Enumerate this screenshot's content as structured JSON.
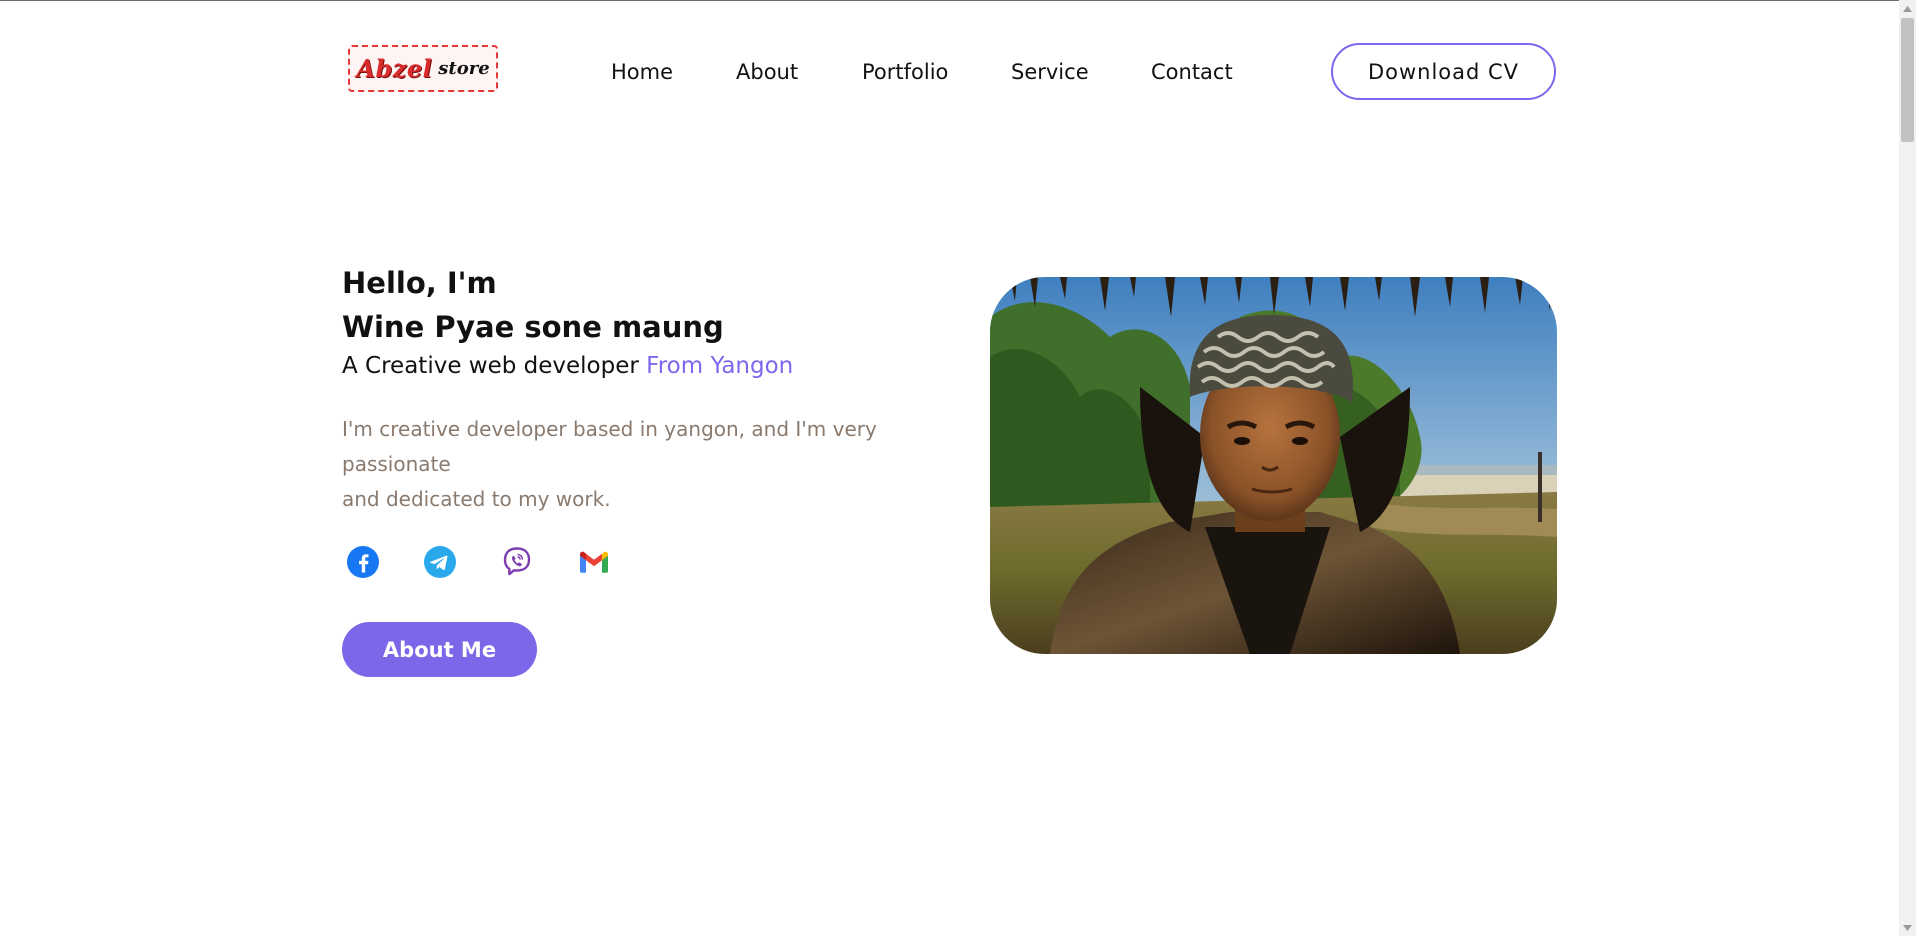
{
  "header": {
    "logo": {
      "main": "Abzel",
      "sub": "store"
    },
    "nav": [
      {
        "label": "Home"
      },
      {
        "label": "About"
      },
      {
        "label": "Portfolio"
      },
      {
        "label": "Service"
      },
      {
        "label": "Contact"
      }
    ],
    "download_cv_label": "Download CV"
  },
  "hero": {
    "greeting": "Hello, I'm",
    "name": "Wine Pyae sone maung",
    "tagline_prefix": "A Creative web developer ",
    "tagline_accent": "From Yangon",
    "bio_lines": [
      "I'm creative developer based in yangon, and I'm very",
      "passionate",
      "and dedicated to my work."
    ],
    "socials": [
      {
        "icon": "facebook-icon",
        "color": "#1877f2"
      },
      {
        "icon": "telegram-icon",
        "color": "#29a9eb"
      },
      {
        "icon": "viber-icon",
        "color": "#7d3daf"
      },
      {
        "icon": "gmail-icon",
        "color": "#ea4335"
      }
    ],
    "about_button_label": "About Me",
    "photo_icon": "portrait-photo"
  },
  "colors": {
    "accent": "#7b68ee",
    "button_fill": "#7b68e8",
    "bio_text": "#8a7a6e",
    "logo_red": "#d92b2b"
  }
}
